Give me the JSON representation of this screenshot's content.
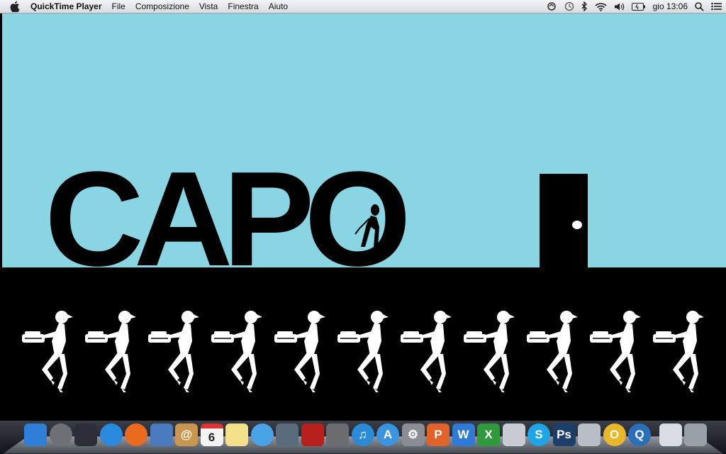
{
  "menubar": {
    "app_name": "QuickTime Player",
    "menus": [
      "File",
      "Composizione",
      "Vista",
      "Finestra",
      "Aiuto"
    ],
    "clock": "gio 13:06"
  },
  "video": {
    "title": "CAPO"
  },
  "dock": {
    "items": [
      {
        "name": "finder-icon",
        "color": "#2f7fd8",
        "glyph": ""
      },
      {
        "name": "launchpad-icon",
        "color": "#6f6f78",
        "glyph": ""
      },
      {
        "name": "mission-control-icon",
        "color": "#2e2e3a",
        "glyph": ""
      },
      {
        "name": "safari-icon",
        "color": "#2a8ae0",
        "glyph": ""
      },
      {
        "name": "firefox-icon",
        "color": "#e86b1f",
        "glyph": ""
      },
      {
        "name": "preview-icon",
        "color": "#4a7abf",
        "glyph": ""
      },
      {
        "name": "contacts-icon",
        "color": "#c8964f",
        "glyph": "@"
      },
      {
        "name": "calendar-icon",
        "color": "#f3f3f3",
        "glyph": "6"
      },
      {
        "name": "notes-icon",
        "color": "#f3e18a",
        "glyph": ""
      },
      {
        "name": "messages-icon",
        "color": "#4aa3e6",
        "glyph": ""
      },
      {
        "name": "facetime-icon",
        "color": "#5a6b7c",
        "glyph": ""
      },
      {
        "name": "photo-booth-icon",
        "color": "#b8201d",
        "glyph": ""
      },
      {
        "name": "iphoto-icon",
        "color": "#6c6c70",
        "glyph": ""
      },
      {
        "name": "itunes-icon",
        "color": "#2b8bd6",
        "glyph": "♫"
      },
      {
        "name": "app-store-icon",
        "color": "#3a94e0",
        "glyph": "A"
      },
      {
        "name": "system-preferences-icon",
        "color": "#8a8d93",
        "glyph": "⚙"
      },
      {
        "name": "powerpoint-icon",
        "color": "#e0642a",
        "glyph": "P"
      },
      {
        "name": "word-icon",
        "color": "#2f7ad6",
        "glyph": "W"
      },
      {
        "name": "excel-icon",
        "color": "#2f9a3c",
        "glyph": "X"
      },
      {
        "name": "calculator-icon",
        "color": "#c8ccd2",
        "glyph": ""
      },
      {
        "name": "skype-icon",
        "color": "#1ea5e6",
        "glyph": "S"
      },
      {
        "name": "photoshop-icon",
        "color": "#1b3f6a",
        "glyph": "Ps"
      },
      {
        "name": "migration-icon",
        "color": "#b9bec6",
        "glyph": ""
      },
      {
        "name": "outlook-icon",
        "color": "#e8b82a",
        "glyph": "O"
      },
      {
        "name": "quicktime-icon",
        "color": "#2a6fb8",
        "glyph": "Q"
      },
      {
        "name": "downloads-stack-icon",
        "color": "#d9dde3",
        "glyph": ""
      },
      {
        "name": "trash-icon",
        "color": "#9aa0a8",
        "glyph": ""
      }
    ]
  }
}
